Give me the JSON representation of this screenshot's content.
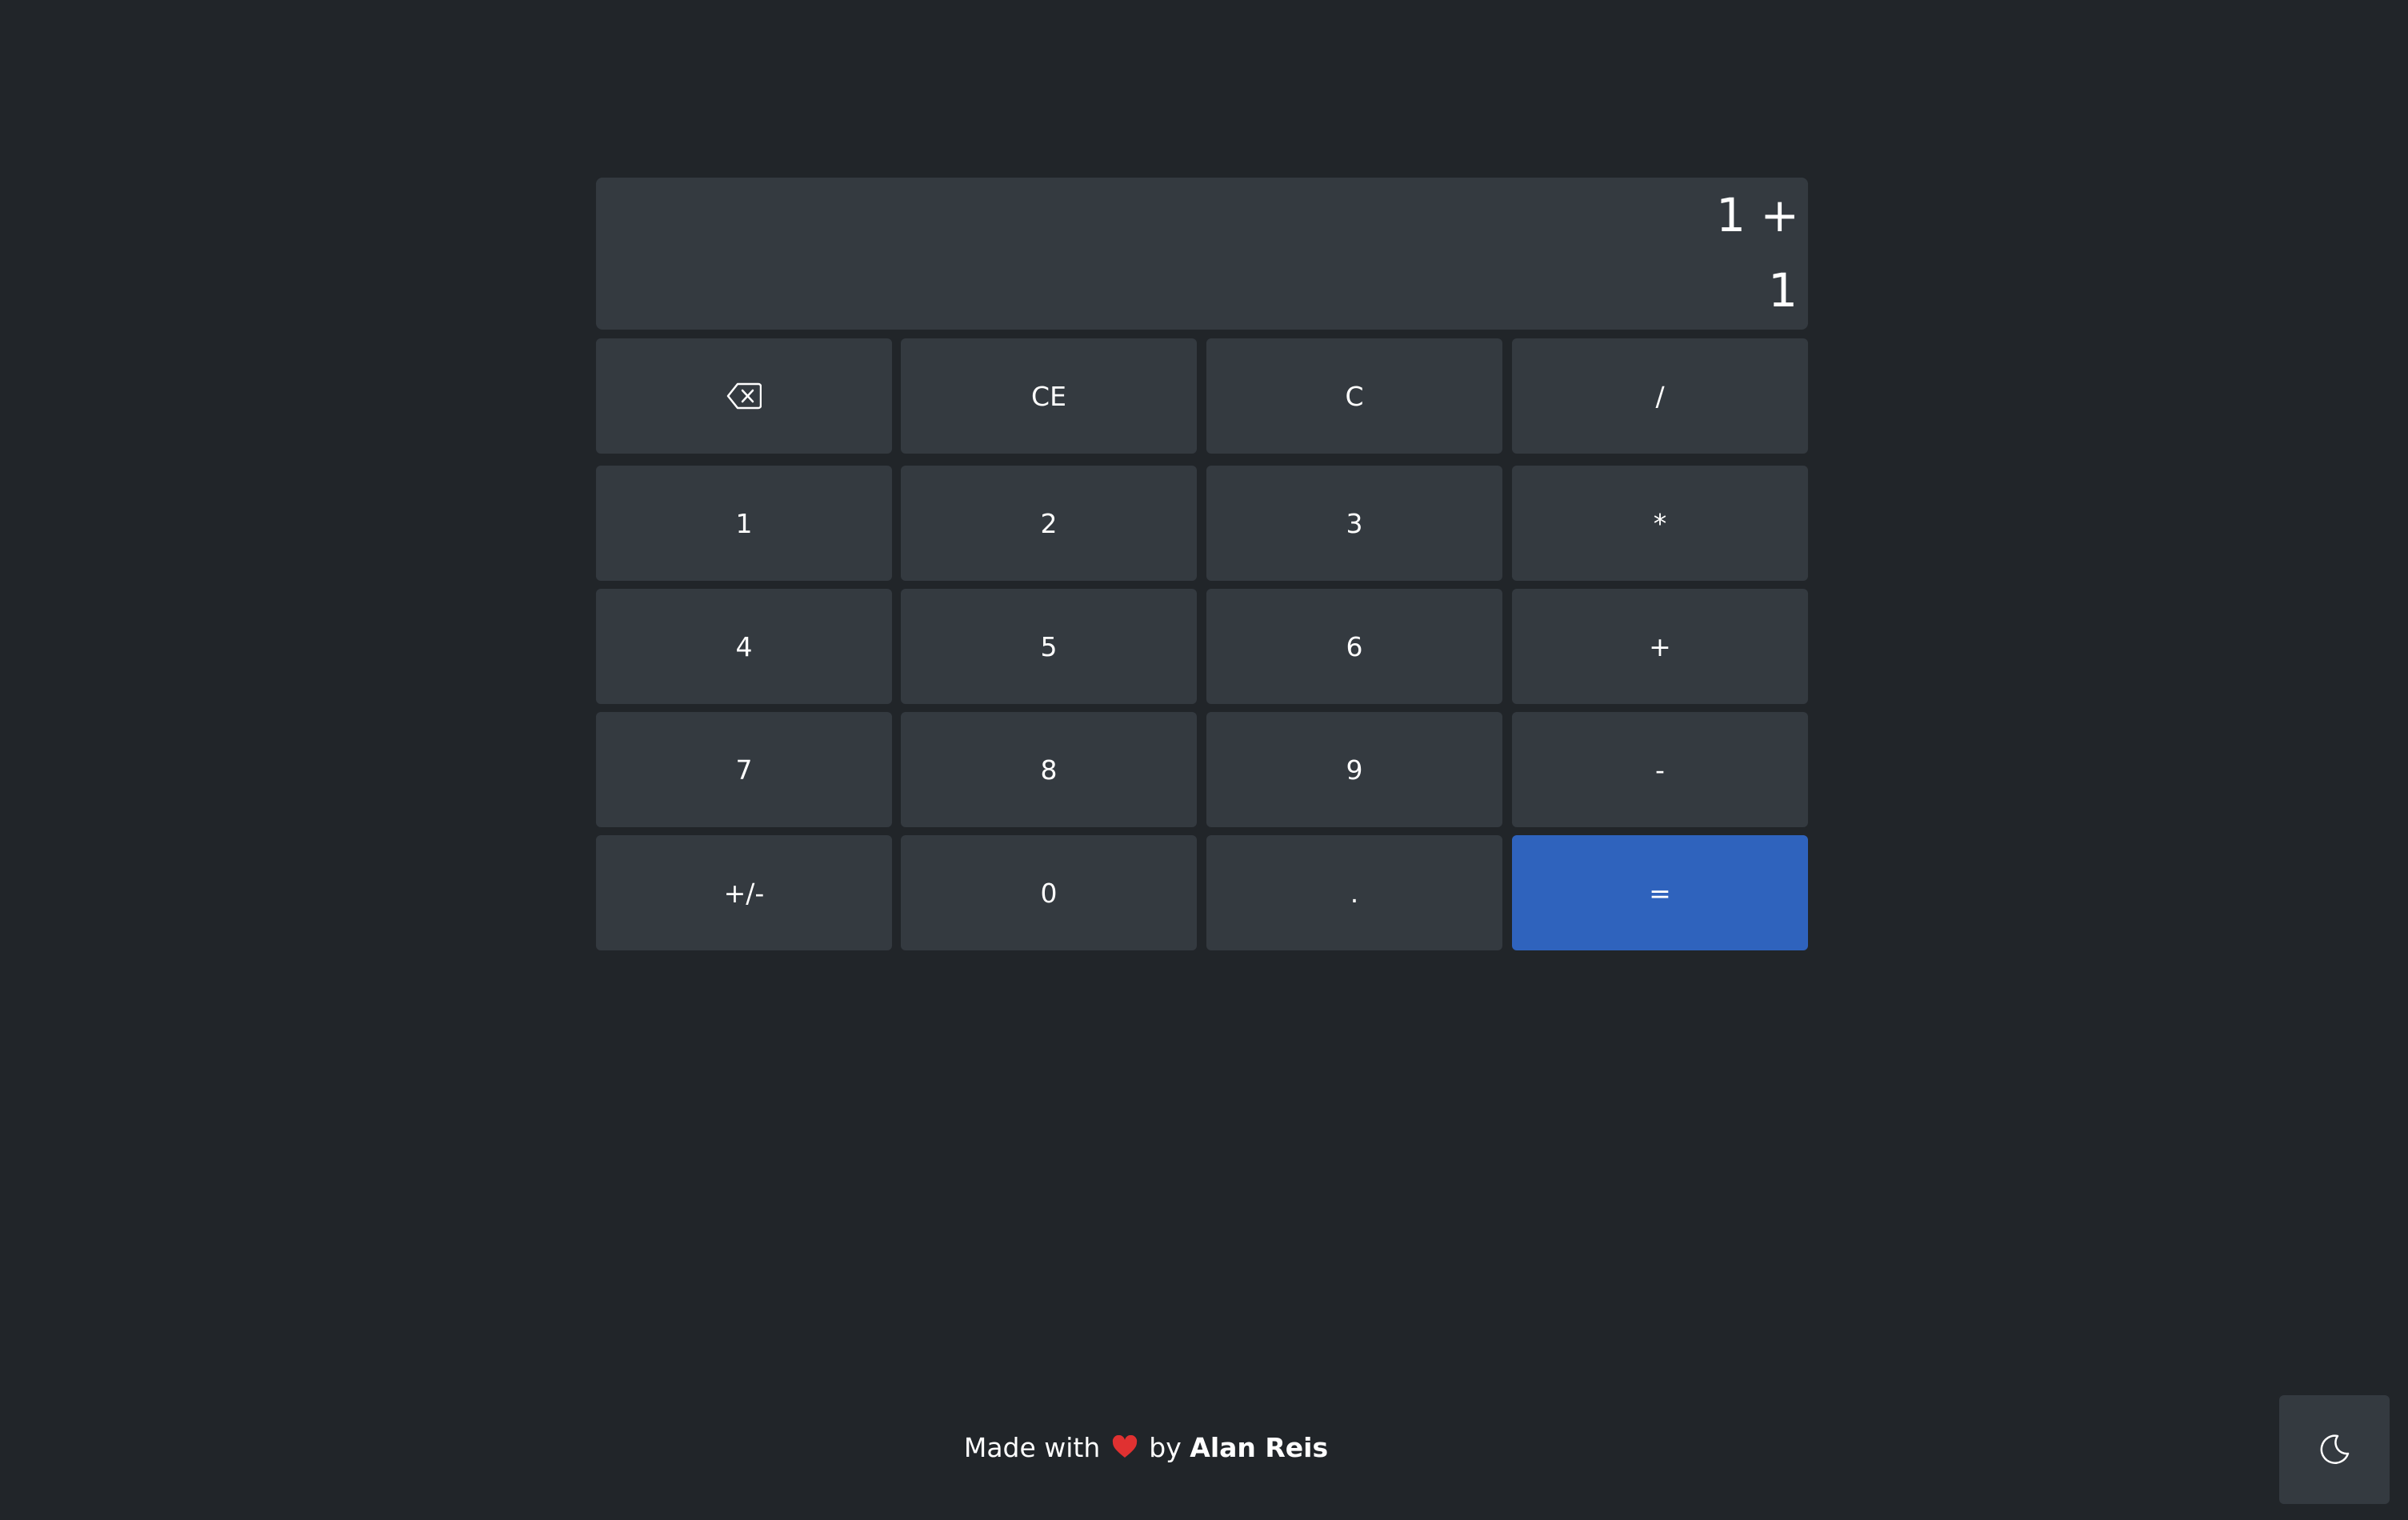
{
  "display": {
    "expression": "1 +",
    "current": "1"
  },
  "keys": {
    "backspace": "backspace-icon",
    "ce": "CE",
    "c": "C",
    "divide": "/",
    "one": "1",
    "two": "2",
    "three": "3",
    "multiply": "*",
    "four": "4",
    "five": "5",
    "six": "6",
    "plus": "+",
    "seven": "7",
    "eight": "8",
    "nine": "9",
    "minus": "-",
    "negate": "+/-",
    "zero": "0",
    "decimal": ".",
    "equals": "="
  },
  "footer": {
    "prefix": "Made with",
    "heart": "heart-icon",
    "by": "by",
    "author": "Alan Reis"
  },
  "theme_toggle": {
    "icon": "moon-icon"
  },
  "colors": {
    "background": "#212529",
    "surface": "#343a40",
    "accent": "#2f63bd",
    "heart": "#e03131",
    "text": "#ffffff"
  }
}
